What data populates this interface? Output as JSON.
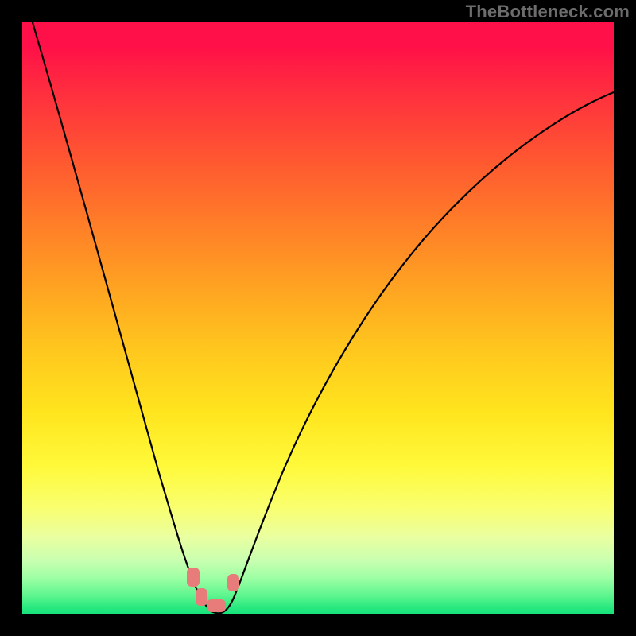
{
  "watermark": "TheBottleneck.com",
  "chart_data": {
    "type": "line",
    "title": "",
    "xlabel": "",
    "ylabel": "",
    "xlim": [
      0,
      100
    ],
    "ylim": [
      0,
      100
    ],
    "grid": false,
    "legend": false,
    "background_gradient": {
      "top_color": "#ff1048",
      "bottom_color": "#16e37a",
      "note": "vertical rainbow heat gradient, red at top to green at bottom"
    },
    "series": [
      {
        "name": "bottleneck-curve",
        "note": "V-shaped curve; y≈0 near optimum around x≈30–35, rising steeply on both sides",
        "x": [
          0,
          4,
          8,
          12,
          16,
          20,
          24,
          27,
          29,
          31,
          33,
          35,
          38,
          42,
          48,
          55,
          63,
          72,
          82,
          92,
          100
        ],
        "y": [
          100,
          90,
          78,
          65,
          51,
          37,
          22,
          10,
          3,
          0,
          0,
          2,
          9,
          22,
          38,
          52,
          63,
          72,
          78,
          82,
          84
        ]
      }
    ],
    "markers": [
      {
        "name": "optimum-dot-left",
        "x": 28,
        "y": 6
      },
      {
        "name": "optimum-dot-mid",
        "x": 30,
        "y": 1
      },
      {
        "name": "optimum-dot-base",
        "x": 32,
        "y": 0
      },
      {
        "name": "optimum-dot-right",
        "x": 35,
        "y": 4
      }
    ],
    "marker_style": {
      "color": "#e77c7b",
      "shape": "rounded-rect"
    }
  }
}
